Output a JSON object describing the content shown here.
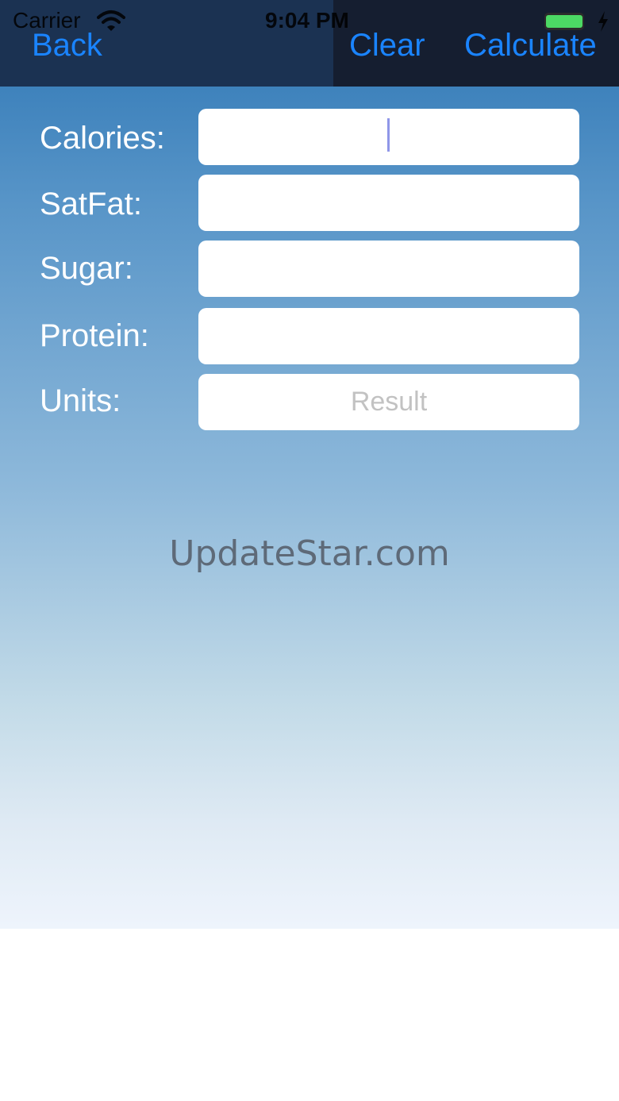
{
  "status_bar": {
    "carrier": "Carrier",
    "time": "9:04 PM",
    "wifi_icon": "wifi-icon",
    "battery_icon": "battery-icon",
    "charging_icon": "charging-bolt-icon"
  },
  "nav": {
    "back_label": "Back",
    "clear_label": "Clear",
    "calculate_label": "Calculate"
  },
  "form": {
    "calories_label": "Calories:",
    "calories_value": "",
    "satfat_label": "SatFat:",
    "satfat_value": "",
    "sugar_label": "Sugar:",
    "sugar_value": "",
    "protein_label": "Protein:",
    "protein_value": "",
    "units_label": "Units:",
    "units_placeholder": "Result"
  },
  "watermark": "UpdateStar.com",
  "colors": {
    "accent": "#1a84ff",
    "nav_bar": "#1b3252",
    "gradient_top": "#3e82bc",
    "gradient_bottom": "#eef4fc"
  }
}
